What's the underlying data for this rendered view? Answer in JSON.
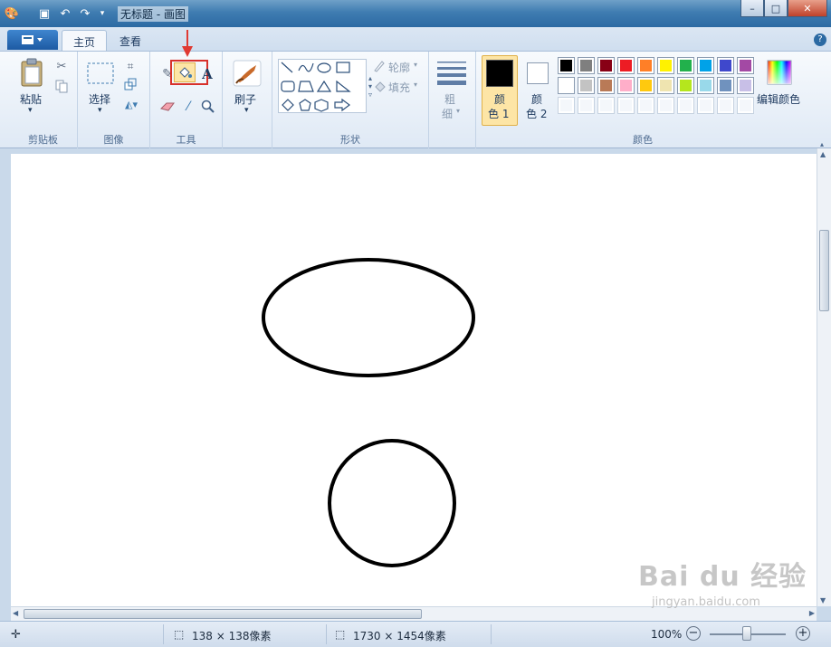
{
  "window": {
    "title": "无标题 - 画图",
    "minimize": "–",
    "maximize": "□",
    "close": "✕"
  },
  "ribbon": {
    "tabs": [
      {
        "label": "主页",
        "active": true
      },
      {
        "label": "查看",
        "active": false
      }
    ],
    "help": "?",
    "clipboard": {
      "paste_label": "粘贴",
      "group_label": "剪贴板"
    },
    "image": {
      "select_label": "选择",
      "group_label": "图像"
    },
    "tools": {
      "group_label": "工具",
      "selected_tool": "fill-bucket"
    },
    "brushes": {
      "label": "刷子"
    },
    "shapes": {
      "outline_label": "轮廓",
      "fill_label": "填充",
      "group_label": "形状"
    },
    "size": {
      "label_line1": "粗",
      "label_line2": "细"
    },
    "colors": {
      "color1_label_line1": "颜",
      "color1_label_line2": "色 1",
      "color2_label_line1": "颜",
      "color2_label_line2": "色 2",
      "color1_value": "#000000",
      "color2_value": "#ffffff",
      "edit_label": "编辑颜色",
      "group_label": "颜色",
      "palette_row1": [
        "#000000",
        "#7f7f7f",
        "#880015",
        "#ed1c24",
        "#ff7f27",
        "#fff200",
        "#22b14c",
        "#00a2e8",
        "#3f48cc",
        "#a349a4"
      ],
      "palette_row2": [
        "#ffffff",
        "#c3c3c3",
        "#b97a57",
        "#ffaec9",
        "#ffc90e",
        "#efe4b0",
        "#b5e61d",
        "#99d9ea",
        "#7092be",
        "#c8bfe7"
      ]
    }
  },
  "status": {
    "selection_size": "138 × 138像素",
    "canvas_size": "1730 × 1454像素",
    "zoom": "100%"
  },
  "watermark": {
    "text": "Bai du 经验",
    "sub": "jingyan.baidu.com"
  }
}
